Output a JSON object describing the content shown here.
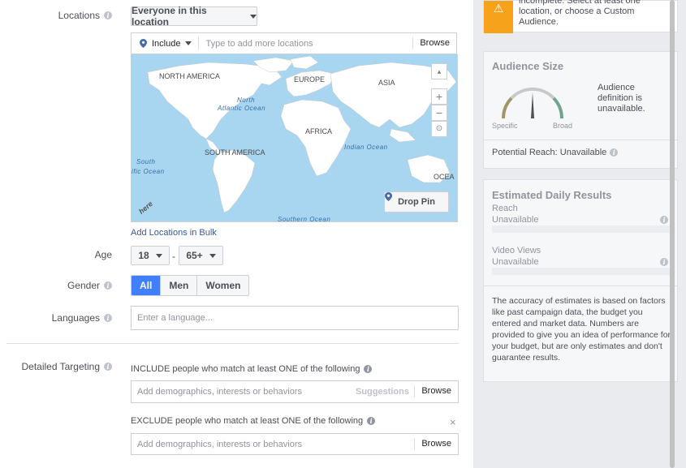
{
  "locations": {
    "label": "Locations",
    "type_select": "Everyone in this location",
    "include_select": "Include",
    "input_placeholder": "Type to add more locations",
    "browse": "Browse",
    "map_labels": [
      "NORTH AMERICA",
      "EUROPE",
      "ASIA",
      "AFRICA",
      "SOUTH AMERICA",
      "OCEA"
    ],
    "ocean_labels": [
      "North",
      "Atlantic Ocean",
      "Indian Ocean",
      "South",
      "ific Ocean",
      "Southern Ocean"
    ],
    "map_attribution": "here",
    "drop_pin": "Drop Pin",
    "zoom_in": "+",
    "zoom_out": "−",
    "bulk_link": "Add Locations in Bulk"
  },
  "age": {
    "label": "Age",
    "min": "18",
    "separator": "-",
    "max": "65+"
  },
  "gender": {
    "label": "Gender",
    "options": [
      "All",
      "Men",
      "Women"
    ],
    "selected": "All"
  },
  "languages": {
    "label": "Languages",
    "placeholder": "Enter a language..."
  },
  "detailed_targeting": {
    "label": "Detailed Targeting",
    "include_text": "INCLUDE people who match at least ONE of the following",
    "include_placeholder": "Add demographics, interests or behaviors",
    "suggestions": "Suggestions",
    "browse": "Browse",
    "exclude_text": "EXCLUDE people who match at least ONE of the following",
    "exclude_placeholder": "Add demographics, interests or behaviors",
    "exclude_browse": "Browse",
    "close": "×"
  },
  "warning": {
    "text_line1": "incomplete. Select at least one",
    "text_line2": "location, or choose a Custom",
    "text_line3": "Audience."
  },
  "audience_size": {
    "title": "Audience Size",
    "gauge_text": "Audience definition is unavailable.",
    "specific": "Specific",
    "broad": "Broad",
    "potential_reach": "Potential Reach: Unavailable"
  },
  "daily_results": {
    "title": "Estimated Daily Results",
    "reach_label": "Reach",
    "reach_value": "Unavailable",
    "video_label": "Video Views",
    "video_value": "Unavailable",
    "accuracy_text": "The accuracy of estimates is based on factors like past campaign data, the budget you entered and market data. Numbers are provided to give you an idea of performance for your budget, but are only estimates and don't guarantee results."
  },
  "colors": {
    "accent_blue": "#4080ff",
    "warning_orange": "#f7a21b",
    "link_blue": "#365899",
    "ocean": "#a8d5f0",
    "land": "#ffffff"
  }
}
